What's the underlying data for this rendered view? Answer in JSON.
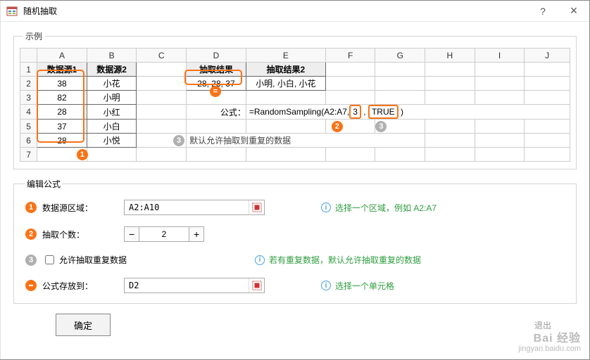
{
  "window": {
    "title": "随机抽取",
    "help": "?",
    "close": "×"
  },
  "example": {
    "legend": "示例",
    "columns": [
      "",
      "A",
      "B",
      "C",
      "D",
      "E",
      "F",
      "G",
      "H",
      "I",
      "J"
    ],
    "rows": [
      "1",
      "2",
      "3",
      "4",
      "5",
      "6",
      "7"
    ],
    "headers": {
      "A1": "数据源1",
      "B1": "数据源2",
      "D1": "抽取结果",
      "E1": "抽取结果2"
    },
    "dataA": [
      "38",
      "82",
      "28",
      "37",
      "28"
    ],
    "dataB": [
      "小花",
      "小明",
      "小红",
      "小白",
      "小悦"
    ],
    "D2": "28, 28, 37",
    "E2": "小明, 小白, 小花",
    "formula_label": "公式：",
    "formula_prefix": "=RandomSampling(A2:A7,",
    "formula_p1": "3",
    "formula_mid": " , ",
    "formula_p2": "TRUE",
    "formula_suffix": " )",
    "note": "默认允许抽取到重复的数据",
    "badge1": "1",
    "badgeEq": "=",
    "badge2": "2",
    "badge3": "3",
    "badgeNote": "3"
  },
  "editor": {
    "legend": "编辑公式",
    "range_label": "数据源区域：",
    "range_value": "A2:A10",
    "range_hint": "选择一个区域，例如 A2:A7",
    "count_label": "抽取个数：",
    "count_value": "2",
    "dup_label": "允许抽取重复数据",
    "dup_hint": "若有重复数据，默认允许抽取重复的数据",
    "dest_label": "公式存放到：",
    "dest_value": "D2",
    "dest_hint": "选择一个单元格",
    "b1": "1",
    "b2": "2",
    "b3": "3",
    "bdest": "⊖"
  },
  "buttons": {
    "ok": "确定",
    "exit": "退出"
  },
  "watermark": {
    "l1": "Bai 经验",
    "l2": "jingyan.baidu.com"
  }
}
